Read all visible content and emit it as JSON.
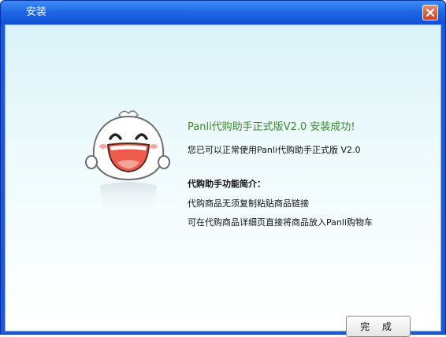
{
  "window": {
    "title": "安装"
  },
  "titlebar": {
    "close_icon": "close-icon"
  },
  "content": {
    "success_message": "Panli代购助手正式版V2.0 安装成功!",
    "usage_message": "您已可以正常使用Panli代购助手正式版 V2.0",
    "features_title": "代购助手功能简介：",
    "features": [
      "代购商品无须复制粘贴商品链接",
      "可在代购商品详细页直接将商品放入Panli购物车"
    ],
    "mascot_icon": "laughing-bun-mascot-icon"
  },
  "buttons": {
    "finish_label": "完 成"
  },
  "colors": {
    "titlebar": "#2168e6",
    "success_text": "#3a8a2a",
    "client_background": "#d9f2f8"
  }
}
